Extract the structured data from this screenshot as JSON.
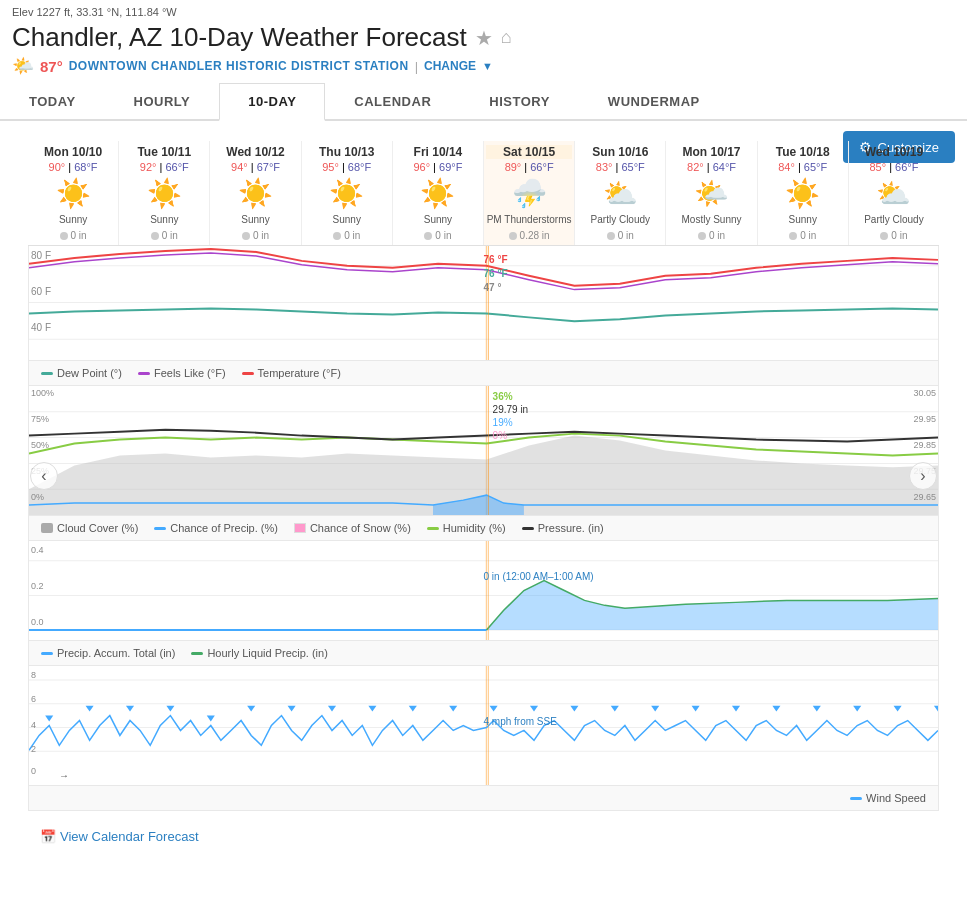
{
  "header": {
    "elev": "Elev 1227 ft, 33.31 °N, 111.84 °W",
    "title": "Chandler, AZ 10-Day Weather Forecast",
    "temp": "87°",
    "station": "DOWNTOWN CHANDLER HISTORIC DISTRICT STATION",
    "change": "CHANGE",
    "star_icon": "★",
    "home_icon": "⌂",
    "sun_icon": "🌤"
  },
  "tabs": [
    {
      "label": "TODAY",
      "active": false
    },
    {
      "label": "HOURLY",
      "active": false
    },
    {
      "label": "10-DAY",
      "active": true
    },
    {
      "label": "CALENDAR",
      "active": false
    },
    {
      "label": "HISTORY",
      "active": false
    },
    {
      "label": "WUNDERMAP",
      "active": false
    }
  ],
  "customize_btn": "Customize",
  "days": [
    {
      "date": "Mon 10/10",
      "high": "90°",
      "low": "68°F",
      "icon": "☀",
      "condition": "Sunny",
      "precip": "0 in"
    },
    {
      "date": "Tue 10/11",
      "high": "92°",
      "low": "66°F",
      "icon": "☀",
      "condition": "Sunny",
      "precip": "0 in"
    },
    {
      "date": "Wed 10/12",
      "high": "94°",
      "low": "67°F",
      "icon": "☀",
      "condition": "Sunny",
      "precip": "0 in"
    },
    {
      "date": "Thu 10/13",
      "high": "95°",
      "low": "68°F",
      "icon": "☀",
      "condition": "Sunny",
      "precip": "0 in"
    },
    {
      "date": "Fri 10/14",
      "high": "96°",
      "low": "69°F",
      "icon": "☀",
      "condition": "Sunny",
      "precip": "0 in"
    },
    {
      "date": "Sat 10/15",
      "high": "89°",
      "low": "66°F",
      "icon": "⛈",
      "condition": "PM Thunderstorms",
      "precip": "0.28 in",
      "highlight": true
    },
    {
      "date": "Sun 10/16",
      "high": "83°",
      "low": "65°F",
      "icon": "⛅",
      "condition": "Partly Cloudy",
      "precip": "0 in"
    },
    {
      "date": "Mon 10/17",
      "high": "82°",
      "low": "64°F",
      "icon": "🌤",
      "condition": "Mostly Sunny",
      "precip": "0 in"
    },
    {
      "date": "Tue 10/18",
      "high": "84°",
      "low": "65°F",
      "icon": "☀",
      "condition": "Sunny",
      "precip": "0 in"
    },
    {
      "date": "Wed 10/19",
      "high": "85°",
      "low": "66°F",
      "icon": "⛅",
      "condition": "Partly Cloudy",
      "precip": "0 in"
    }
  ],
  "temp_chart": {
    "y_labels": [
      "80 F",
      "60 F",
      "40 F"
    ],
    "legend": [
      {
        "label": "Dew Point (°)",
        "color": "#4a9"
      },
      {
        "label": "Feels Like (°F)",
        "color": "#a4c"
      },
      {
        "label": "Temperature (°F)",
        "color": "#e44"
      }
    ],
    "tooltip": {
      "temp": "76 °F",
      "feel": "76 °F",
      "dew": "47 °"
    }
  },
  "precip_chart": {
    "y_labels": [
      "100%",
      "75%",
      "50%",
      "25%",
      "0%"
    ],
    "y_right": [
      "30.05",
      "29.95",
      "29.85",
      "29.75",
      "29.65"
    ],
    "tooltip": {
      "humidity": "36%",
      "pressure": "29.79 in",
      "precip": "19%",
      "snow": "0%"
    },
    "legend": [
      {
        "label": "Cloud Cover (%)",
        "color": "#aaa"
      },
      {
        "label": "Chance of Precip. (%)",
        "color": "#4af"
      },
      {
        "label": "Chance of Snow (%)",
        "color": "#f9c"
      },
      {
        "label": "Humidity (%)",
        "color": "#8c4"
      },
      {
        "label": "Pressure. (in)",
        "color": "#333"
      }
    ]
  },
  "accum_chart": {
    "y_labels": [
      "0.4",
      "0.2",
      "0.0"
    ],
    "tooltip": "0 in (12:00 AM–1:00 AM)",
    "legend": [
      {
        "label": "Precip. Accum. Total (in)",
        "color": "#4af"
      },
      {
        "label": "Hourly Liquid Precip. (in)",
        "color": "#4a6"
      }
    ]
  },
  "wind_chart": {
    "y_labels": [
      "8",
      "6",
      "4",
      "2",
      "0"
    ],
    "tooltip": "4 mph from SSE",
    "legend": [
      {
        "label": "Wind Speed",
        "color": "#4af"
      }
    ],
    "arrow": "→"
  },
  "footer": {
    "link": "View Calendar Forecast",
    "icon": "📅"
  }
}
